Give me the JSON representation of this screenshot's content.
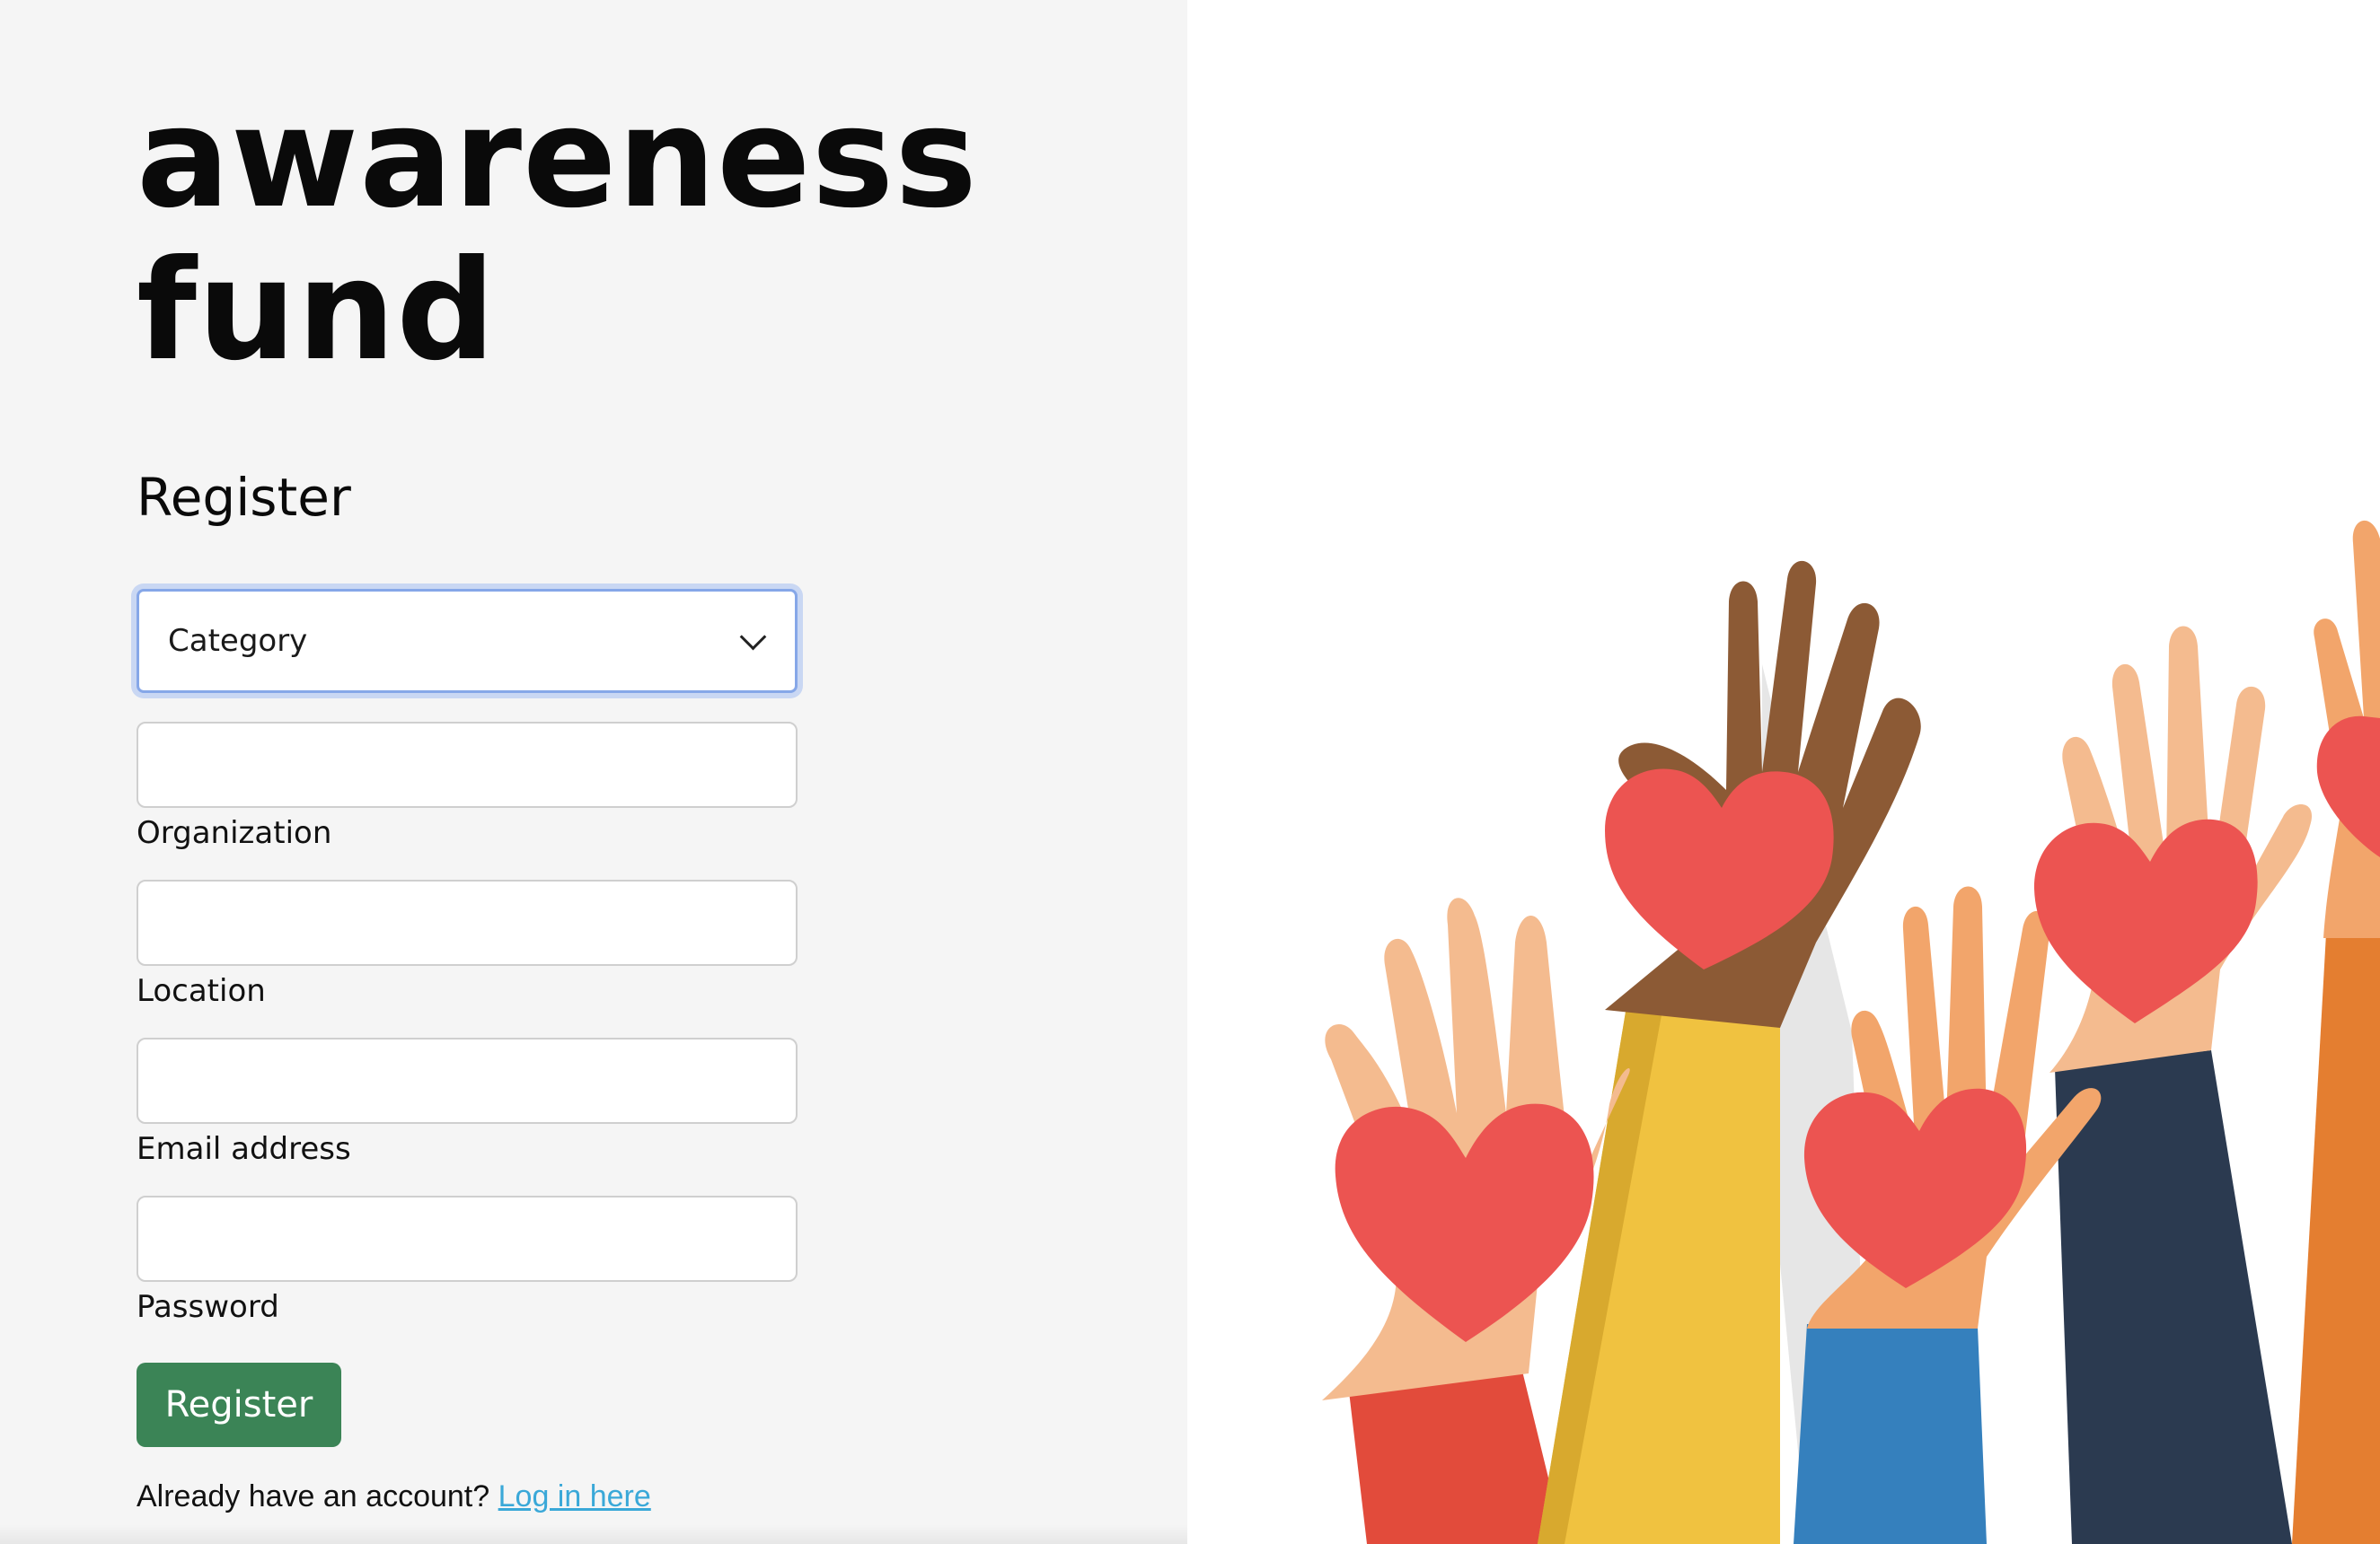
{
  "brand": {
    "line1": "awareness",
    "line2": "fund"
  },
  "form": {
    "title": "Register",
    "category": {
      "selected": "Category"
    },
    "fields": {
      "organization": "Organization",
      "location": "Location",
      "email": "Email address",
      "password": "Password"
    },
    "submit_label": "Register",
    "login_prompt": "Already have an account?",
    "login_link": "Log in here"
  },
  "colors": {
    "left_background": "#f5f5f5",
    "register_button": "#3b8456",
    "link": "#3aa8d8",
    "heart": "#ec5451"
  },
  "illustration": {
    "subject": "raised-hands-with-hearts"
  }
}
